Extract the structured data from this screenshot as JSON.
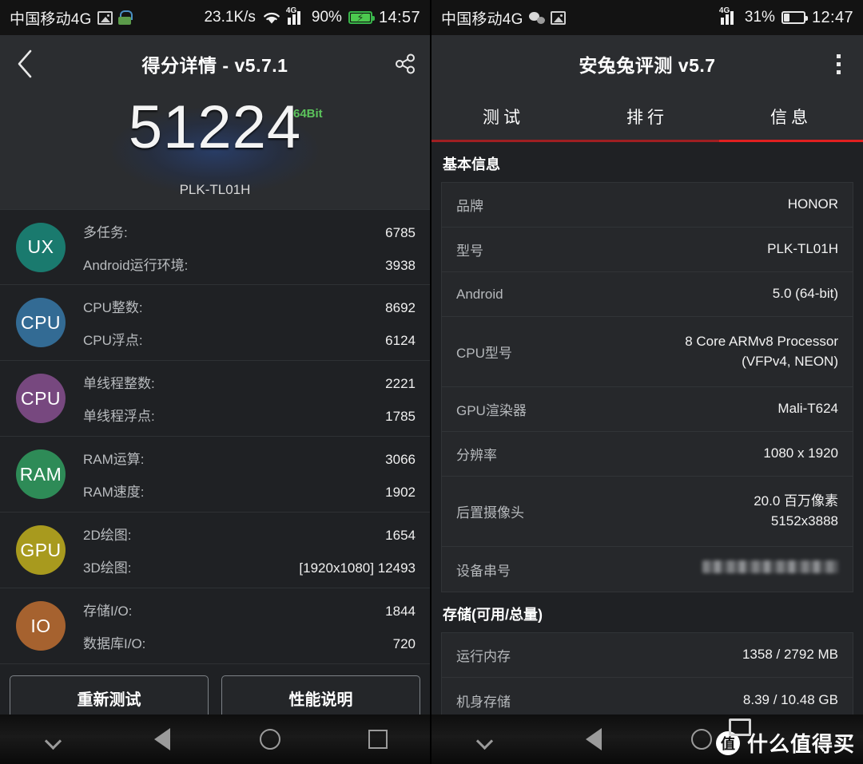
{
  "left_phone": {
    "statusbar": {
      "carrier": "中国移动4G",
      "icons": [
        "photo-icon",
        "lock-icon"
      ],
      "net_speed": "23.1K/s",
      "wifi": "wifi-icon",
      "signal_label": "4G",
      "battery_pct": "90%",
      "battery_state": "charging",
      "time": "14:57"
    },
    "actionbar": {
      "back_icon": "back-chevron-icon",
      "title": "得分详情 - v5.7.1",
      "share_icon": "share-icon"
    },
    "hero": {
      "score": "51224",
      "bit_badge": "64Bit",
      "model": "PLK-TL01H"
    },
    "score_groups": [
      {
        "badge": "UX",
        "color": "#1a7a6e",
        "items": [
          {
            "name": "多任务:",
            "value": "6785"
          },
          {
            "name": "Android运行环境:",
            "value": "3938"
          }
        ]
      },
      {
        "badge": "CPU",
        "color": "#336b94",
        "items": [
          {
            "name": "CPU整数:",
            "value": "8692"
          },
          {
            "name": "CPU浮点:",
            "value": "6124"
          }
        ]
      },
      {
        "badge": "CPU",
        "color": "#77487f",
        "items": [
          {
            "name": "单线程整数:",
            "value": "2221"
          },
          {
            "name": "单线程浮点:",
            "value": "1785"
          }
        ]
      },
      {
        "badge": "RAM",
        "color": "#2e8b57",
        "items": [
          {
            "name": "RAM运算:",
            "value": "3066"
          },
          {
            "name": "RAM速度:",
            "value": "1902"
          }
        ]
      },
      {
        "badge": "GPU",
        "color": "#a89a1e",
        "items": [
          {
            "name": "2D绘图:",
            "value": "1654"
          },
          {
            "name": "3D绘图:",
            "value": "[1920x1080] 12493"
          }
        ]
      },
      {
        "badge": "IO",
        "color": "#a6622f",
        "items": [
          {
            "name": "存储I/O:",
            "value": "1844"
          },
          {
            "name": "数据库I/O:",
            "value": "720"
          }
        ]
      }
    ],
    "buttons": {
      "retest": "重新测试",
      "performance_info": "性能说明"
    },
    "navbar": [
      "chevron-down-icon",
      "back-triangle-icon",
      "home-circle-icon",
      "recents-square-icon"
    ]
  },
  "right_phone": {
    "statusbar": {
      "carrier": "中国移动4G",
      "icons": [
        "wechat-icon",
        "photo-icon"
      ],
      "signal_label": "4G",
      "battery_pct": "31%",
      "battery_state": "discharging",
      "time": "12:47"
    },
    "actionbar": {
      "title": "安兔兔评测 v5.7",
      "menu_icon": "overflow-menu-icon"
    },
    "tabs": [
      {
        "label": "测试",
        "active": false
      },
      {
        "label": "排行",
        "active": false
      },
      {
        "label": "信息",
        "active": true
      }
    ],
    "accent_color": "#e02020",
    "sections": [
      {
        "title": "基本信息",
        "rows": [
          {
            "key": "品牌",
            "value": "HONOR",
            "tall": false,
            "redacted": false
          },
          {
            "key": "型号",
            "value": "PLK-TL01H",
            "tall": false,
            "redacted": false
          },
          {
            "key": "Android",
            "value": "5.0 (64-bit)",
            "tall": false,
            "redacted": false
          },
          {
            "key": "CPU型号",
            "value": "8 Core ARMv8 Processor\n(VFPv4, NEON)",
            "tall": true,
            "redacted": false
          },
          {
            "key": "GPU渲染器",
            "value": "Mali-T624",
            "tall": false,
            "redacted": false
          },
          {
            "key": "分辨率",
            "value": "1080 x 1920",
            "tall": false,
            "redacted": false
          },
          {
            "key": "后置摄像头",
            "value": "20.0 百万像素\n5152x3888",
            "tall": true,
            "redacted": false
          },
          {
            "key": "设备串号",
            "value": "",
            "tall": false,
            "redacted": true
          }
        ]
      },
      {
        "title": "存储(可用/总量)",
        "rows": [
          {
            "key": "运行内存",
            "value": "1358 / 2792 MB",
            "tall": false,
            "redacted": false
          },
          {
            "key": "机身存储",
            "value": "8.39 / 10.48 GB",
            "tall": false,
            "redacted": false
          }
        ]
      }
    ],
    "navbar": [
      "chevron-down-icon",
      "back-triangle-icon",
      "home-circle-icon"
    ],
    "watermark": {
      "logo": "值",
      "text": "什么值得买"
    }
  }
}
